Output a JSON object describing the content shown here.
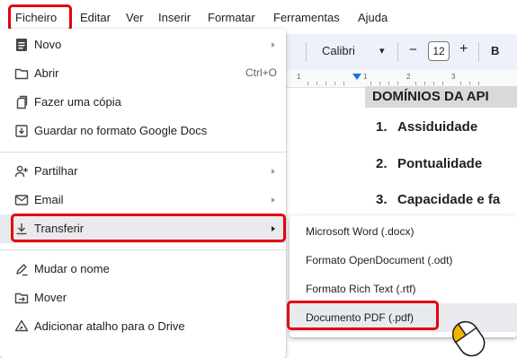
{
  "menubar": {
    "items": [
      "Ficheiro",
      "Editar",
      "Ver",
      "Inserir",
      "Formatar",
      "Ferramentas",
      "Ajuda"
    ]
  },
  "toolbar": {
    "font": "Calibri",
    "font_size": "12",
    "minus": "−",
    "plus": "+",
    "bold": "B",
    "dropdown_glyph": "▾"
  },
  "ruler": {
    "marks": [
      "1",
      "1",
      "2",
      "3"
    ]
  },
  "document": {
    "title": "DOMÍNIOS DA API",
    "items": [
      {
        "num": "1.",
        "text": "Assiduidade"
      },
      {
        "num": "2.",
        "text": "Pontualidade"
      },
      {
        "num": "3.",
        "text": "Capacidade e fa"
      }
    ]
  },
  "file_menu": {
    "items": [
      {
        "label": "Novo",
        "icon": "document-icon",
        "submenu": true
      },
      {
        "label": "Abrir",
        "icon": "folder-icon",
        "shortcut": "Ctrl+O"
      },
      {
        "label": "Fazer uma cópia",
        "icon": "copy-icon"
      },
      {
        "label": "Guardar no formato Google Docs",
        "icon": "save-icon"
      },
      {
        "label": "Partilhar",
        "icon": "person-add-icon",
        "submenu": true
      },
      {
        "label": "Email",
        "icon": "email-icon",
        "submenu": true
      },
      {
        "label": "Transferir",
        "icon": "download-icon",
        "submenu": true,
        "active": true
      },
      {
        "label": "Mudar o nome",
        "icon": "rename-icon"
      },
      {
        "label": "Mover",
        "icon": "move-icon"
      },
      {
        "label": "Adicionar atalho para o Drive",
        "icon": "drive-shortcut-icon"
      }
    ]
  },
  "download_submenu": {
    "items": [
      {
        "label": "Microsoft Word (.docx)"
      },
      {
        "label": "Formato OpenDocument (.odt)"
      },
      {
        "label": "Formato Rich Text (.rtf)"
      },
      {
        "label": "Documento PDF (.pdf)",
        "active": true
      }
    ]
  },
  "colors": {
    "highlight": "#e3000f",
    "active_bg": "#e8eaed",
    "toolbar_bg": "#edf2fa",
    "cursor_fill": "#f4b400"
  }
}
